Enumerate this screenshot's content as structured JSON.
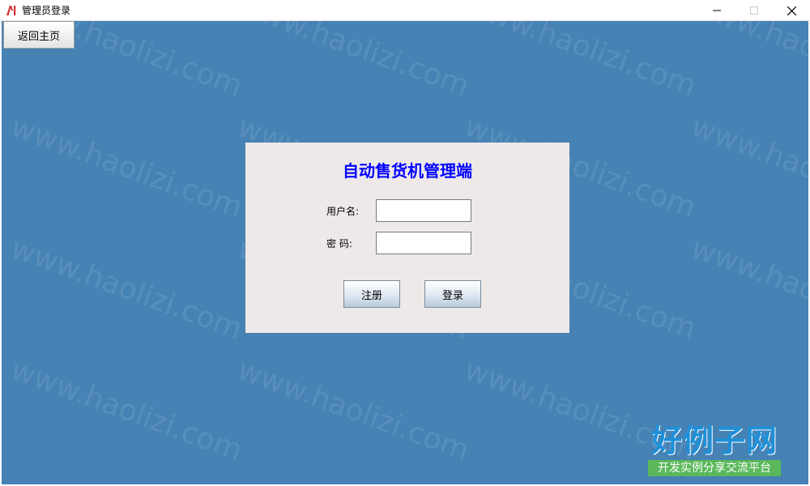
{
  "window": {
    "title": "管理员登录"
  },
  "toolbar": {
    "back_label": "返回主页"
  },
  "login": {
    "title": "自动售货机管理端",
    "username_label": "用户名:",
    "password_label": "密 码:",
    "username_value": "",
    "password_value": "",
    "register_label": "注册",
    "login_label": "登录"
  },
  "watermark": {
    "text": "www.haolizi.com"
  },
  "logo": {
    "main": "好例子网",
    "sub": "开发实例分享交流平台"
  },
  "colors": {
    "background": "#4682b4",
    "panel": "#eee9e9",
    "title": "#0000ff",
    "logo_green": "#5ab85a"
  }
}
